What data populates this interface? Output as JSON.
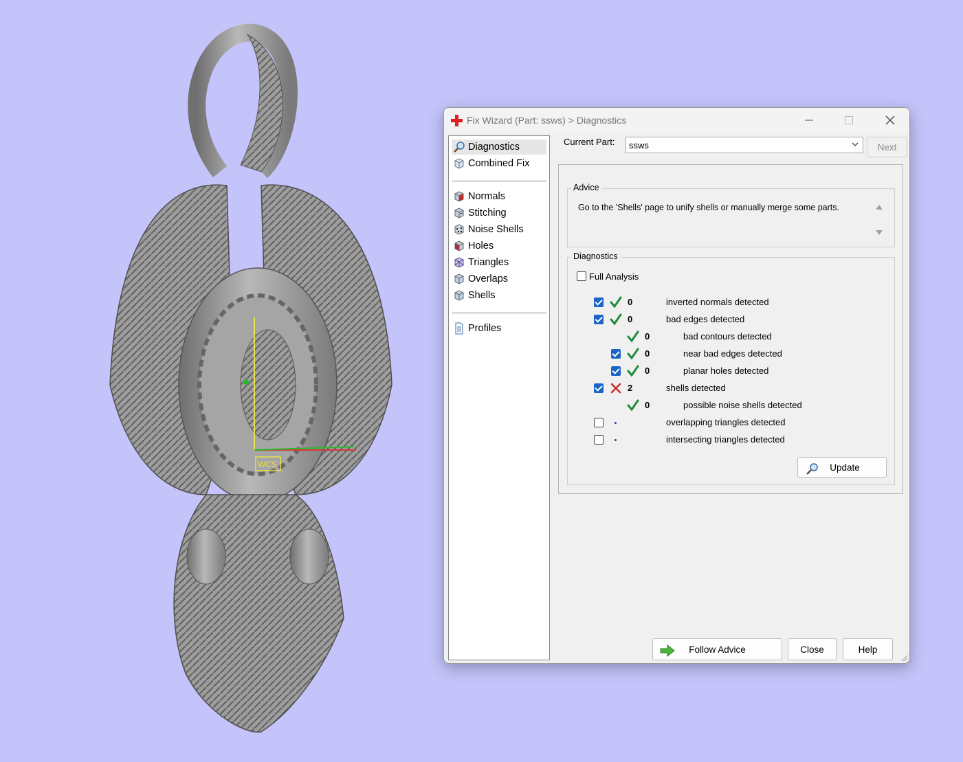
{
  "window": {
    "title": "Fix Wizard (Part: ssws) > Diagnostics"
  },
  "nav": {
    "primary": [
      {
        "label": "Diagnostics",
        "icon": "magnifier-icon",
        "active": true
      },
      {
        "label": "Combined Fix",
        "icon": "cube-icon"
      }
    ],
    "tools": [
      {
        "label": "Normals",
        "icon": "normals-cube-icon"
      },
      {
        "label": "Stitching",
        "icon": "stitching-cube-icon"
      },
      {
        "label": "Noise Shells",
        "icon": "noise-shells-icon"
      },
      {
        "label": "Holes",
        "icon": "holes-cube-icon"
      },
      {
        "label": "Triangles",
        "icon": "triangles-cube-icon"
      },
      {
        "label": "Overlaps",
        "icon": "overlaps-cube-icon"
      },
      {
        "label": "Shells",
        "icon": "shells-cube-icon"
      }
    ],
    "extra": [
      {
        "label": "Profiles",
        "icon": "document-icon"
      }
    ]
  },
  "current_part": {
    "label": "Current Part:",
    "value": "ssws",
    "next_label": "Next"
  },
  "advice": {
    "title": "Advice",
    "text": "Go to the 'Shells' page to unify shells or manually merge some parts."
  },
  "diagnostics": {
    "title": "Diagnostics",
    "full_analysis": {
      "label": "Full Analysis",
      "checked": false
    },
    "rows": [
      {
        "checked": true,
        "status": "ok",
        "count": "0",
        "label": "inverted normals detected",
        "indent": 0,
        "has_checkbox": true
      },
      {
        "checked": true,
        "status": "ok",
        "count": "0",
        "label": "bad edges detected",
        "indent": 0,
        "has_checkbox": true
      },
      {
        "checked": false,
        "status": "ok",
        "count": "0",
        "label": "bad contours detected",
        "indent": 1,
        "has_checkbox": false
      },
      {
        "checked": true,
        "status": "ok",
        "count": "0",
        "label": "near bad edges detected",
        "indent": 1,
        "has_checkbox": true
      },
      {
        "checked": true,
        "status": "ok",
        "count": "0",
        "label": "planar holes detected",
        "indent": 1,
        "has_checkbox": true
      },
      {
        "checked": true,
        "status": "error",
        "count": "2",
        "label": "shells detected",
        "indent": 0,
        "has_checkbox": true
      },
      {
        "checked": false,
        "status": "ok",
        "count": "0",
        "label": "possible noise shells detected",
        "indent": 1,
        "has_checkbox": false
      },
      {
        "checked": false,
        "status": "pending",
        "count": "",
        "label": "overlapping triangles detected",
        "indent": 0,
        "has_checkbox": true
      },
      {
        "checked": false,
        "status": "pending",
        "count": "",
        "label": "intersecting triangles detected",
        "indent": 0,
        "has_checkbox": true
      }
    ],
    "update_label": "Update"
  },
  "footer": {
    "follow_advice_label": "Follow Advice",
    "close_label": "Close",
    "help_label": "Help"
  },
  "viewport": {
    "axis_label": "WCS"
  },
  "colors": {
    "background": "#c4c4fb",
    "model": "#9a9a9a",
    "ok": "#1f8a3a",
    "error": "#cc2a2a",
    "checkbox": "#1c64c7"
  }
}
